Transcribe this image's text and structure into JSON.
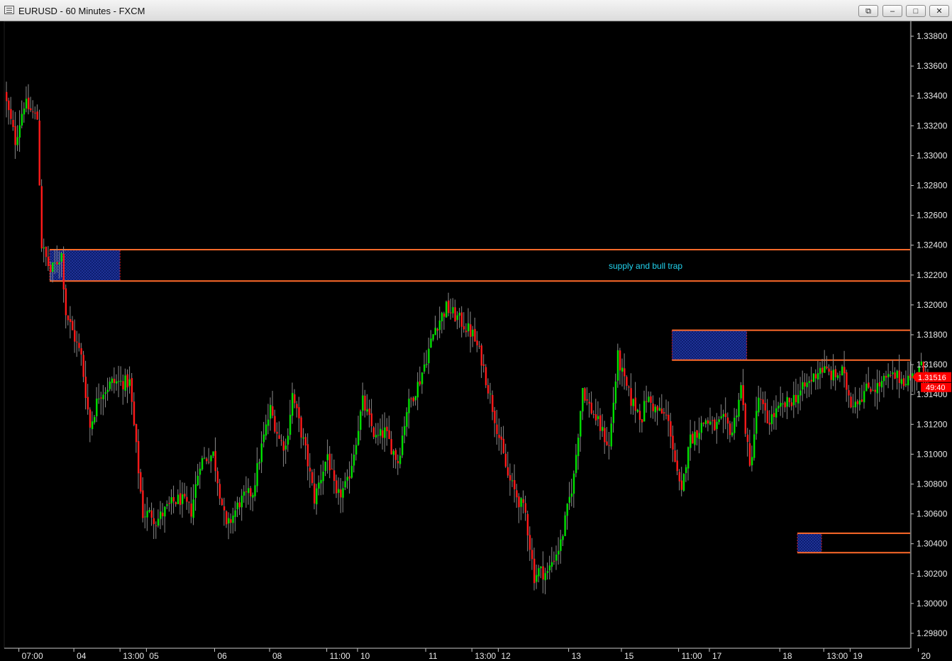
{
  "window": {
    "title": "EURUSD - 60 Minutes - FXCM",
    "icons": {
      "app": "chart-window-icon",
      "restore": "restore-icon",
      "minimize": "minimize-icon",
      "maximize": "maximize-icon",
      "close": "close-icon"
    }
  },
  "colors": {
    "background": "#000000",
    "bull": "#00e000",
    "bear": "#ff1a1a",
    "zone_line": "#ff6a2a",
    "zone_fill": "#0a1a6a",
    "annotation": "#22d3ee",
    "price_tag": "#ff0000",
    "axis_text": "#e8e8e8"
  },
  "chart_data": {
    "type": "candlestick",
    "symbol": "EURUSD",
    "timeframe": "60 Minutes",
    "source": "FXCM",
    "ylim": [
      1.297,
      1.339
    ],
    "y_ticks": [
      "1.33800",
      "1.33600",
      "1.33400",
      "1.33200",
      "1.33000",
      "1.32800",
      "1.32600",
      "1.32400",
      "1.32200",
      "1.32000",
      "1.31800",
      "1.31600",
      "1.31400",
      "1.31200",
      "1.31000",
      "1.30800",
      "1.30600",
      "1.30400",
      "1.30200",
      "1.30000",
      "1.29800"
    ],
    "x_labels": [
      "07:00",
      "04",
      "13:00",
      "05",
      "06",
      "08",
      "11:00",
      "10",
      "11",
      "13:00",
      "12",
      "13",
      "15",
      "11:00",
      "17",
      "18",
      "13:00",
      "19",
      "20"
    ],
    "x_label_pos": [
      6,
      31,
      52,
      64,
      95,
      120,
      146,
      160,
      191,
      212,
      224,
      256,
      280,
      306,
      320,
      352,
      372,
      384,
      415
    ],
    "candle_count": 420,
    "path_pos": [
      0,
      4,
      8,
      14,
      16,
      20,
      25,
      27,
      34,
      38,
      42,
      48,
      56,
      62,
      66,
      68,
      72,
      76,
      79,
      84,
      88,
      94,
      100,
      106,
      112,
      116,
      120,
      124,
      127,
      130,
      136,
      140,
      146,
      150,
      155,
      158,
      162,
      168,
      172,
      178,
      182,
      188,
      195,
      200,
      206,
      212,
      216,
      222,
      228,
      232,
      236,
      240,
      242,
      246,
      248,
      252,
      256,
      258,
      262,
      264,
      268,
      274,
      278,
      281,
      284,
      289,
      291,
      295,
      300,
      302,
      305,
      307,
      310,
      318,
      322,
      326,
      330,
      334,
      338,
      342,
      346,
      350,
      356,
      360,
      366,
      370,
      376,
      380,
      384,
      388,
      392,
      396,
      400,
      404,
      408,
      412,
      416,
      419
    ],
    "path_val": [
      1.3335,
      1.331,
      1.3335,
      1.3325,
      1.324,
      1.3222,
      1.3234,
      1.3195,
      1.3165,
      1.3118,
      1.314,
      1.3148,
      1.3148,
      1.306,
      1.306,
      1.3055,
      1.3062,
      1.3068,
      1.307,
      1.3062,
      1.3095,
      1.31,
      1.305,
      1.3068,
      1.3075,
      1.3105,
      1.313,
      1.311,
      1.3105,
      1.314,
      1.3102,
      1.307,
      1.31,
      1.307,
      1.308,
      1.3102,
      1.3135,
      1.311,
      1.3115,
      1.3095,
      1.313,
      1.315,
      1.3185,
      1.3198,
      1.319,
      1.318,
      1.3164,
      1.3125,
      1.3085,
      1.3072,
      1.306,
      1.3018,
      1.3022,
      1.302,
      1.3028,
      1.304,
      1.307,
      1.3085,
      1.3145,
      1.3135,
      1.3124,
      1.3105,
      1.3165,
      1.3148,
      1.3136,
      1.3125,
      1.3138,
      1.313,
      1.3125,
      1.3115,
      1.3085,
      1.3072,
      1.3108,
      1.3123,
      1.3118,
      1.3122,
      1.3115,
      1.3145,
      1.309,
      1.3138,
      1.3122,
      1.3128,
      1.3135,
      1.314,
      1.315,
      1.3158,
      1.3152,
      1.3155,
      1.3135,
      1.3138,
      1.3145,
      1.3145,
      1.315,
      1.3152,
      1.315,
      1.3152,
      1.3158,
      1.3152
    ],
    "zones": [
      {
        "upper": 1.3237,
        "lower": 1.3216,
        "box_start": 20,
        "box_end": 52,
        "label": "supply and bull trap"
      },
      {
        "upper": 1.3183,
        "lower": 1.3163,
        "box_start": 303,
        "box_end": 337,
        "label": ""
      },
      {
        "upper": 1.3047,
        "lower": 1.3034,
        "box_start": 360,
        "box_end": 371,
        "label": ""
      }
    ],
    "current_price": "1.31516",
    "countdown": "49:40"
  }
}
